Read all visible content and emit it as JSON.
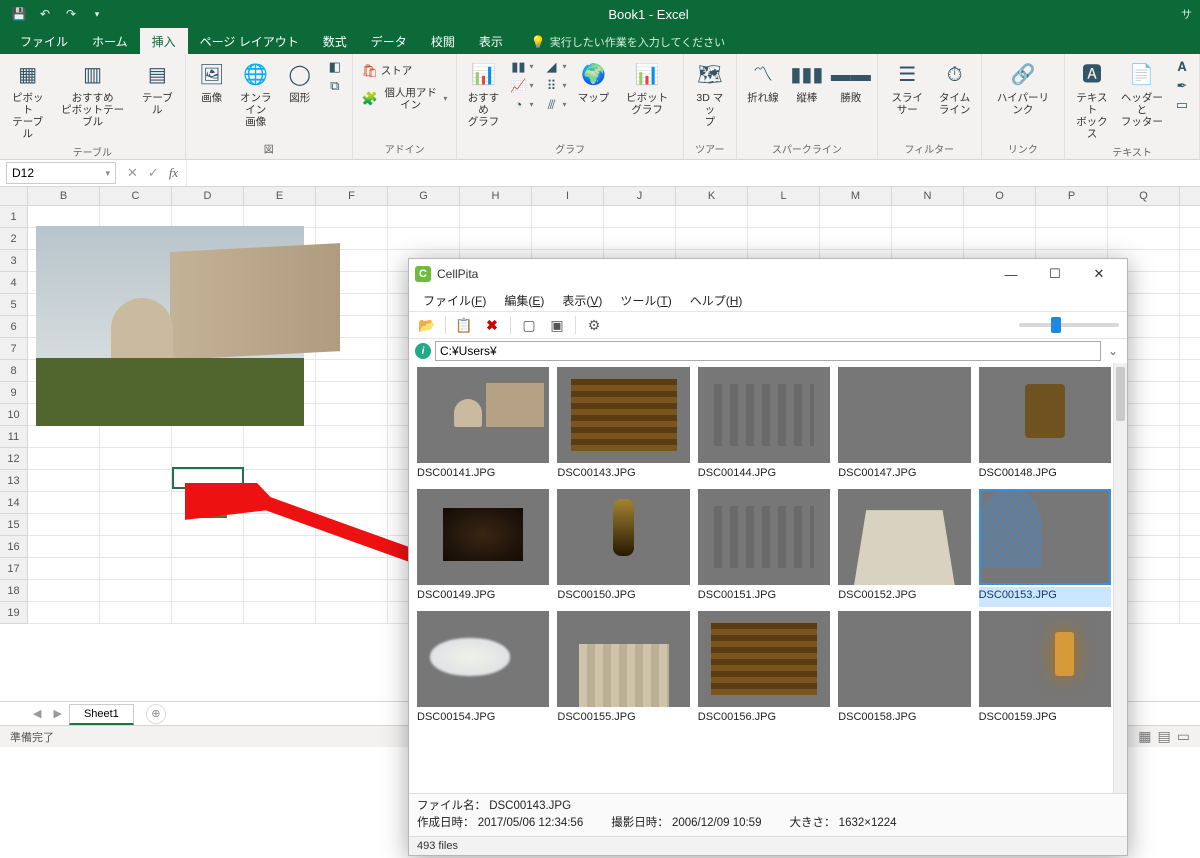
{
  "excel": {
    "title": "Book1 - Excel",
    "right_hint": "サ",
    "qat_items": [
      "save-icon",
      "undo-icon",
      "redo-icon",
      "customize-icon"
    ],
    "tabs": [
      "ファイル",
      "ホーム",
      "挿入",
      "ページ レイアウト",
      "数式",
      "データ",
      "校閲",
      "表示"
    ],
    "active_tab": "挿入",
    "tellme": "実行したい作業を入力してください",
    "groups": {
      "tables": {
        "label": "テーブル",
        "items": [
          "ピボット\nテーブル",
          "おすすめ\nピボットテーブル",
          "テーブル"
        ]
      },
      "illust": {
        "label": "図",
        "items": [
          "画像",
          "オンライン\n画像",
          "図形"
        ]
      },
      "addins": {
        "label": "アドイン",
        "store": "ストア",
        "my": "個人用アドイン"
      },
      "charts": {
        "label": "グラフ",
        "rec": "おすすめ\nグラフ",
        "map": "マップ",
        "pivot": "ピボットグラフ"
      },
      "tours": {
        "label": "ツアー",
        "item": "3D マッ\nプ"
      },
      "spark": {
        "label": "スパークライン",
        "items": [
          "折れ線",
          "縦棒",
          "勝敗"
        ]
      },
      "filter": {
        "label": "フィルター",
        "items": [
          "スライサー",
          "タイム\nライン"
        ]
      },
      "link": {
        "label": "リンク",
        "item": "ハイパーリンク"
      },
      "text": {
        "label": "テキスト",
        "items": [
          "テキスト\nボックス",
          "ヘッダーと\nフッター"
        ]
      }
    },
    "namebox": "D12",
    "columns": [
      "B",
      "C",
      "D",
      "E",
      "F",
      "G",
      "H",
      "I",
      "J",
      "K",
      "L",
      "M",
      "N",
      "O",
      "P",
      "Q"
    ],
    "rows": [
      "1",
      "2",
      "3",
      "4",
      "5",
      "6",
      "7",
      "8",
      "9",
      "10",
      "11",
      "12",
      "13",
      "14",
      "15",
      "16",
      "17",
      "18",
      "19"
    ],
    "sheet": "Sheet1",
    "status": "準備完了"
  },
  "cellpita": {
    "title": "CellPita",
    "menus": [
      {
        "label": "ファイル",
        "accel": "F"
      },
      {
        "label": "編集",
        "accel": "E"
      },
      {
        "label": "表示",
        "accel": "V"
      },
      {
        "label": "ツール",
        "accel": "T"
      },
      {
        "label": "ヘルプ",
        "accel": "H"
      }
    ],
    "path": "C:¥Users¥",
    "thumbs": [
      {
        "name": "DSC00141.JPG",
        "cls": "t-pisa"
      },
      {
        "name": "DSC00143.JPG",
        "cls": "t-gold"
      },
      {
        "name": "DSC00144.JPG",
        "cls": "t-ceil"
      },
      {
        "name": "DSC00147.JPG",
        "cls": "t-tile"
      },
      {
        "name": "DSC00148.JPG",
        "cls": "t-altar"
      },
      {
        "name": "DSC00149.JPG",
        "cls": "t-darkpaint"
      },
      {
        "name": "DSC00150.JPG",
        "cls": "t-chand"
      },
      {
        "name": "DSC00151.JPG",
        "cls": "t-ceil"
      },
      {
        "name": "DSC00152.JPG",
        "cls": "t-tower"
      },
      {
        "name": "DSC00153.JPG",
        "cls": "t-bapt",
        "selected": true
      },
      {
        "name": "DSC00154.JPG",
        "cls": "t-sky"
      },
      {
        "name": "DSC00155.JPG",
        "cls": "t-facade"
      },
      {
        "name": "DSC00156.JPG",
        "cls": "t-gold"
      },
      {
        "name": "DSC00158.JPG",
        "cls": "t-octo"
      },
      {
        "name": "DSC00159.JPG",
        "cls": "t-warm"
      }
    ],
    "info": {
      "filename_label": "ファイル名：",
      "filename": "DSC00143.JPG",
      "created_label": "作成日時：",
      "created": "2017/05/06 12:34:56",
      "shot_label": "撮影日時：",
      "shot": "2006/12/09 10:59",
      "size_label": "大きさ：",
      "size": "1632×1224"
    },
    "status": "493 files"
  }
}
